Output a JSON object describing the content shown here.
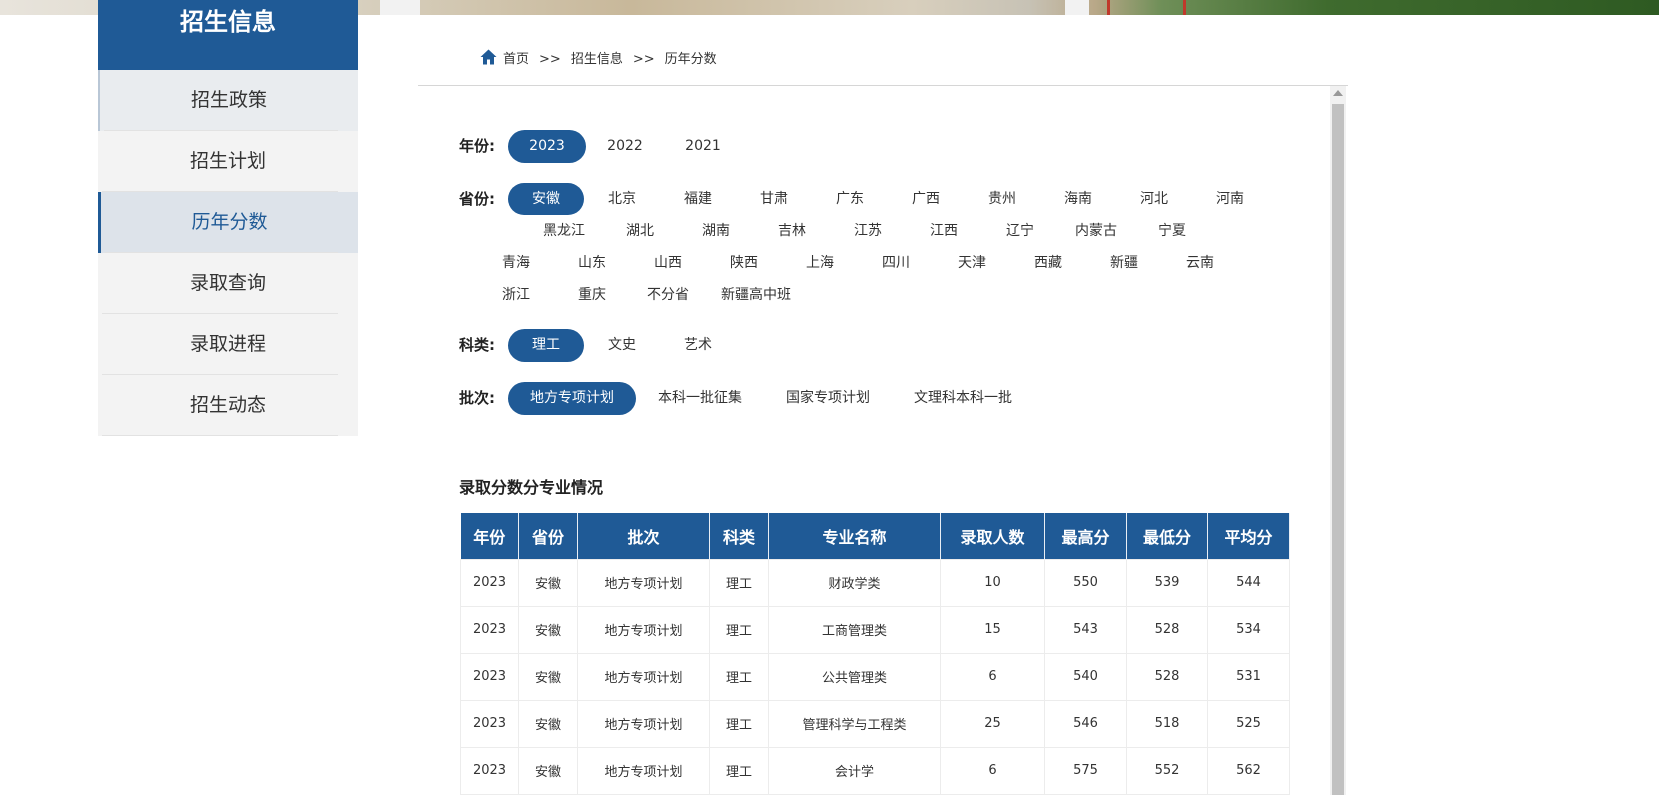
{
  "sidebar": {
    "title": "招生信息",
    "items": [
      {
        "label": "招生政策"
      },
      {
        "label": "招生计划"
      },
      {
        "label": "历年分数"
      },
      {
        "label": "录取查询"
      },
      {
        "label": "录取进程"
      },
      {
        "label": "招生动态"
      }
    ],
    "active_index": 2
  },
  "breadcrumb": {
    "icon": "home-icon",
    "items": [
      "首页",
      "历年分数"
    ],
    "middle": "招生信息",
    "separator": ">>"
  },
  "filters": {
    "year": {
      "label": "年份:",
      "options": [
        "2023",
        "2022",
        "2021"
      ],
      "selected": "2023"
    },
    "province": {
      "label": "省份:",
      "options": [
        "安徽",
        "北京",
        "福建",
        "甘肃",
        "广东",
        "广西",
        "贵州",
        "海南",
        "河北",
        "河南",
        "黑龙江",
        "湖北",
        "湖南",
        "吉林",
        "江苏",
        "江西",
        "辽宁",
        "内蒙古",
        "宁夏",
        "青海",
        "山东",
        "山西",
        "陕西",
        "上海",
        "四川",
        "天津",
        "西藏",
        "新疆",
        "云南",
        "浙江",
        "重庆",
        "不分省",
        "新疆高中班"
      ],
      "selected": "安徽"
    },
    "category": {
      "label": "科类:",
      "options": [
        "理工",
        "文史",
        "艺术"
      ],
      "selected": "理工"
    },
    "batch": {
      "label": "批次:",
      "options": [
        "地方专项计划",
        "本科一批征集",
        "国家专项计划",
        "文理科本科一批"
      ],
      "selected": "地方专项计划"
    }
  },
  "table": {
    "title": "录取分数分专业情况",
    "headers": [
      "年份",
      "省份",
      "批次",
      "科类",
      "专业名称",
      "录取人数",
      "最高分",
      "最低分",
      "平均分"
    ],
    "rows": [
      [
        "2023",
        "安徽",
        "地方专项计划",
        "理工",
        "财政学类",
        "10",
        "550",
        "539",
        "544"
      ],
      [
        "2023",
        "安徽",
        "地方专项计划",
        "理工",
        "工商管理类",
        "15",
        "543",
        "528",
        "534"
      ],
      [
        "2023",
        "安徽",
        "地方专项计划",
        "理工",
        "公共管理类",
        "6",
        "540",
        "528",
        "531"
      ],
      [
        "2023",
        "安徽",
        "地方专项计划",
        "理工",
        "管理科学与工程类",
        "25",
        "546",
        "518",
        "525"
      ],
      [
        "2023",
        "安徽",
        "地方专项计划",
        "理工",
        "会计学",
        "6",
        "575",
        "552",
        "562"
      ]
    ]
  },
  "colors": {
    "brand": "#1f5a96",
    "sidebar_bg": "#f3f3f3"
  }
}
